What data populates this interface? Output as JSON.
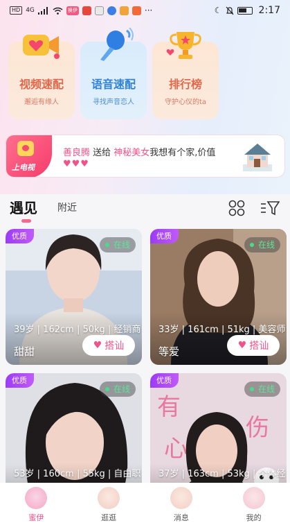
{
  "status_bar": {
    "carrier_tags": [
      "HD",
      "4G"
    ],
    "app_badge": "换伊",
    "time": "2:17",
    "more": "···"
  },
  "features": [
    {
      "title": "视频速配",
      "subtitle": "邂逅有缘人",
      "icon": "video-camera-heart-icon"
    },
    {
      "title": "语音速配",
      "subtitle": "寻找声音恋人",
      "icon": "microphone-icon"
    },
    {
      "title": "排行榜",
      "subtitle": "守护心仪的ta",
      "icon": "trophy-icon"
    }
  ],
  "banner": {
    "tag_label": "上电视",
    "sender": "善良腾",
    "verb": " 送给 ",
    "receiver": "神秘美女",
    "message": "我想有个家,价值",
    "hearts": "♥♥♥"
  },
  "tabs": {
    "meet": "遇见",
    "nearby": "附近"
  },
  "profiles": [
    {
      "badge": "优质",
      "online": "在线",
      "info": "39岁 | 162cm | 50kg | 经销商",
      "name": "甜甜",
      "action": "搭讪"
    },
    {
      "badge": "优质",
      "online": "在线",
      "info": "33岁 | 161cm | 51kg | 美容师",
      "name": "等爱",
      "action": "搭讪"
    },
    {
      "badge": "优质",
      "online": "在线",
      "info": "53岁 | 160cm | 55kg | 自由职",
      "name": "",
      "action": ""
    },
    {
      "badge": "优质",
      "online": "在线",
      "info": "37岁 | 163cm | 53kg | 个体经",
      "name": "",
      "action": ""
    }
  ],
  "nav": [
    {
      "label": "蜜伊",
      "icon": "home-heart-icon"
    },
    {
      "label": "逛逛",
      "icon": "explore-icon"
    },
    {
      "label": "消息",
      "icon": "message-icon"
    },
    {
      "label": "我的",
      "icon": "profile-icon"
    }
  ],
  "colors": {
    "accent_pink": "#f0538b",
    "quality_badge": "#9c3bf6",
    "online_green": "#44de8a"
  }
}
